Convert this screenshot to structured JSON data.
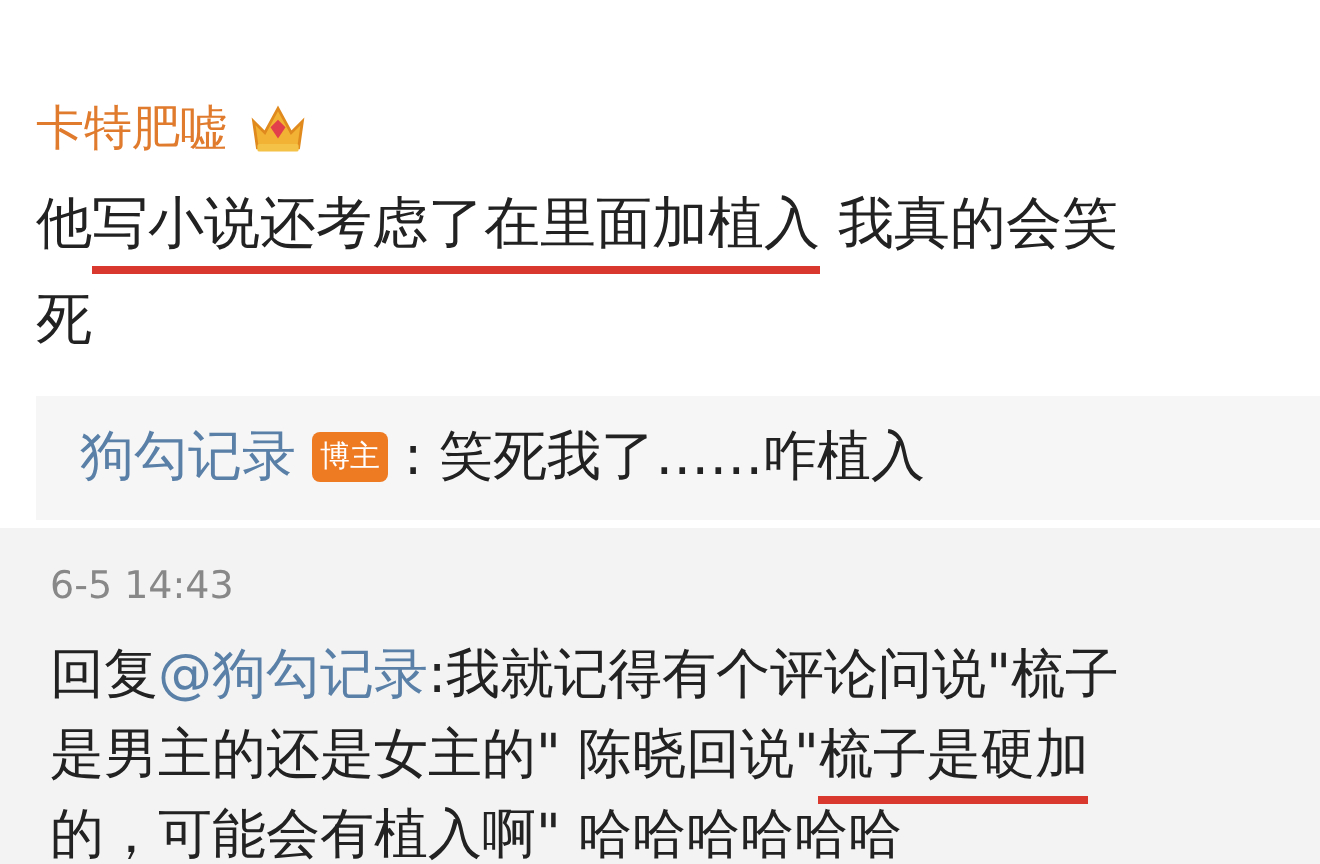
{
  "comment": {
    "author": "卡特肥嘘",
    "text": [
      {
        "text": "他",
        "underlined": false
      },
      {
        "text": "写小说还考虑了在里面加植入",
        "underlined": true
      },
      {
        "text": " 我真的会笑死",
        "underlined": false
      }
    ]
  },
  "quote": {
    "author": "狗勾记录",
    "badge": "博主",
    "text": ": 笑死我了……咋植入"
  },
  "reply": {
    "time": "6-5 14:43",
    "prefix": "回复",
    "mention": "@狗勾记录",
    "text": [
      {
        "text": ":我就记得有个评论问说\"梳子是男主的还是女主的\" 陈晓回说\"",
        "underlined": false
      },
      {
        "text": "梳子是硬加",
        "underlined": true
      },
      {
        "text": "的，可能会有植入啊\" 哈哈哈哈哈哈",
        "underlined": false
      }
    ]
  }
}
